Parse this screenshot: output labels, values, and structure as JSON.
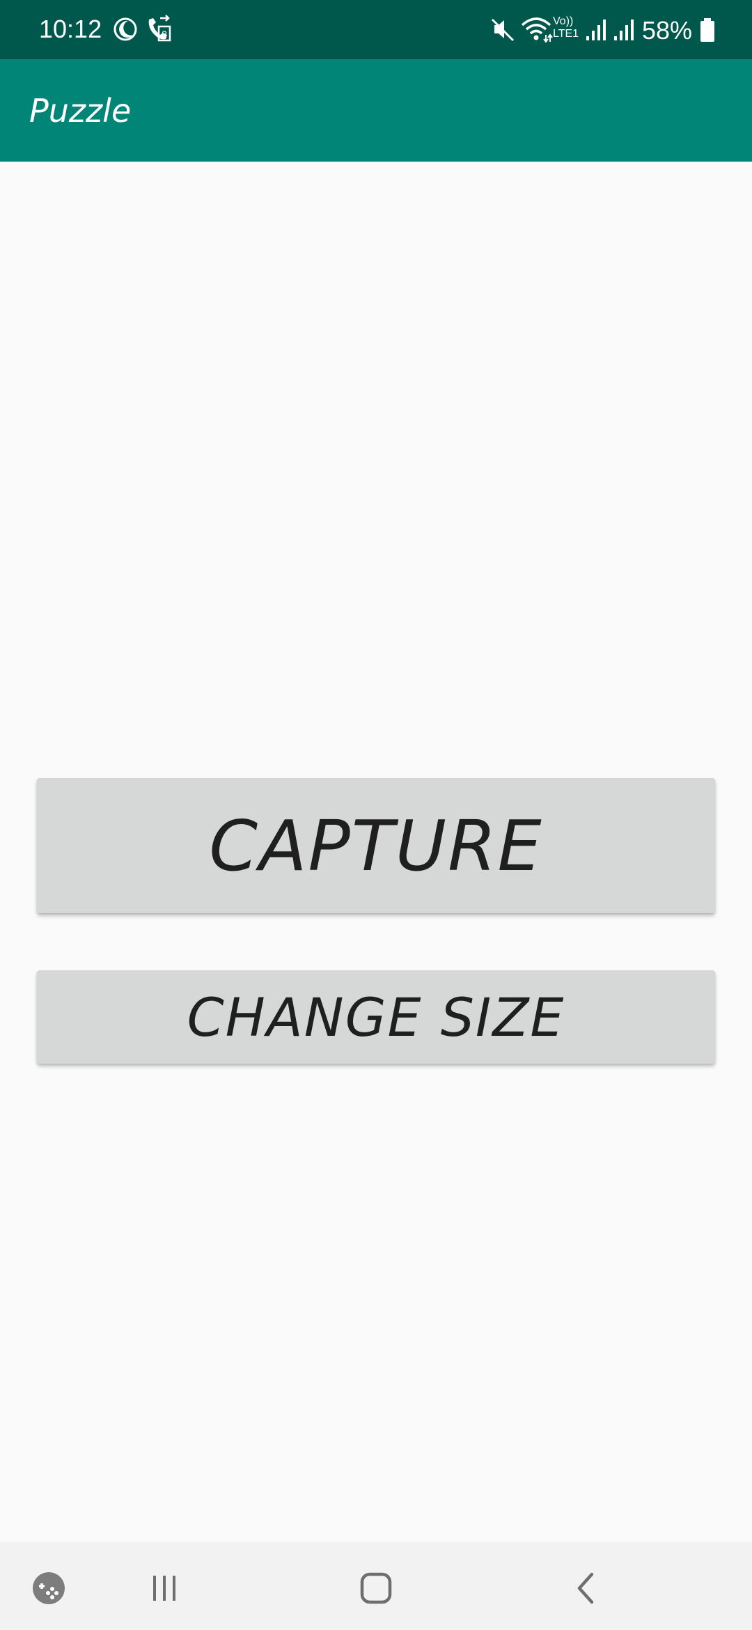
{
  "status_bar": {
    "time": "10:12",
    "battery_percent": "58%",
    "network_labels": [
      "Vo))",
      "LTE1"
    ],
    "icons": [
      "moon-icon",
      "call-transfer-icon",
      "mute-icon",
      "wifi-icon",
      "signal-icon",
      "signal-icon",
      "battery-icon"
    ]
  },
  "app_bar": {
    "title": "Puzzle",
    "color": "#008577"
  },
  "buttons": {
    "capture_label": "CAPTURE",
    "change_size_label": "CHANGE SIZE"
  },
  "nav_bar": {
    "icons": [
      "game-launcher-icon",
      "recent-apps-icon",
      "home-icon",
      "back-icon"
    ]
  }
}
